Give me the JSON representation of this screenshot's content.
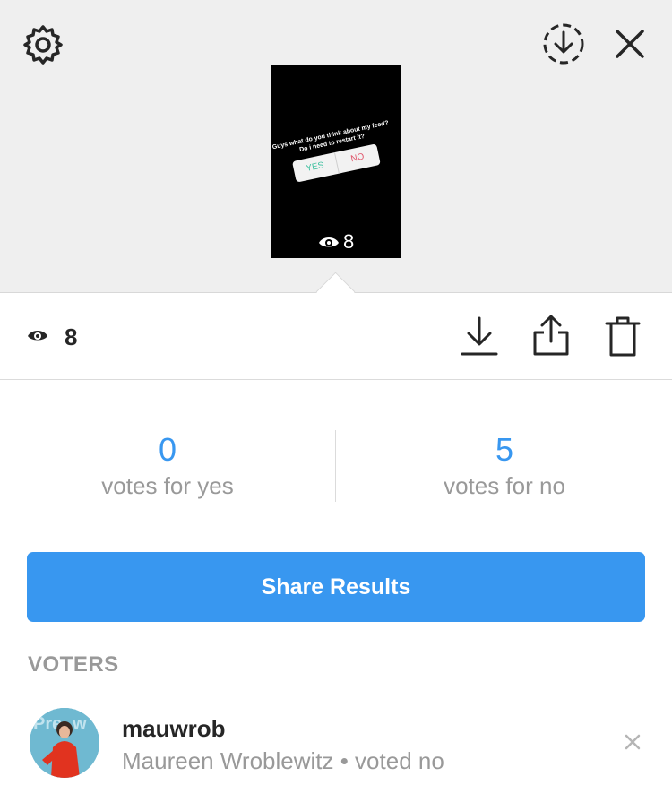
{
  "top_bar": {
    "settings_icon": "gear-icon",
    "download_story_icon": "circle-download-icon",
    "close_icon": "close-icon"
  },
  "story_thumbnail": {
    "question": "Guys what do you think about my feed? Do i need to restart it?",
    "option_yes": "YES",
    "option_no": "NO",
    "views": "8"
  },
  "action_bar": {
    "views_count": "8",
    "view_icon": "eye-icon",
    "download_icon": "download-icon",
    "share_icon": "share-icon",
    "delete_icon": "trash-icon"
  },
  "results": {
    "yes": {
      "count": "0",
      "label": "votes for yes"
    },
    "no": {
      "count": "5",
      "label": "votes for no"
    }
  },
  "share_button_label": "Share Results",
  "voters": {
    "heading": "VOTERS",
    "items": [
      {
        "username": "mauwrob",
        "detail": "Maureen Wroblewitz • voted no"
      }
    ]
  },
  "colors": {
    "accent": "#3897f0",
    "muted_text": "#999999",
    "top_background": "#efefef",
    "poll_yes": "#3bbf9e",
    "poll_no": "#e0556a"
  }
}
